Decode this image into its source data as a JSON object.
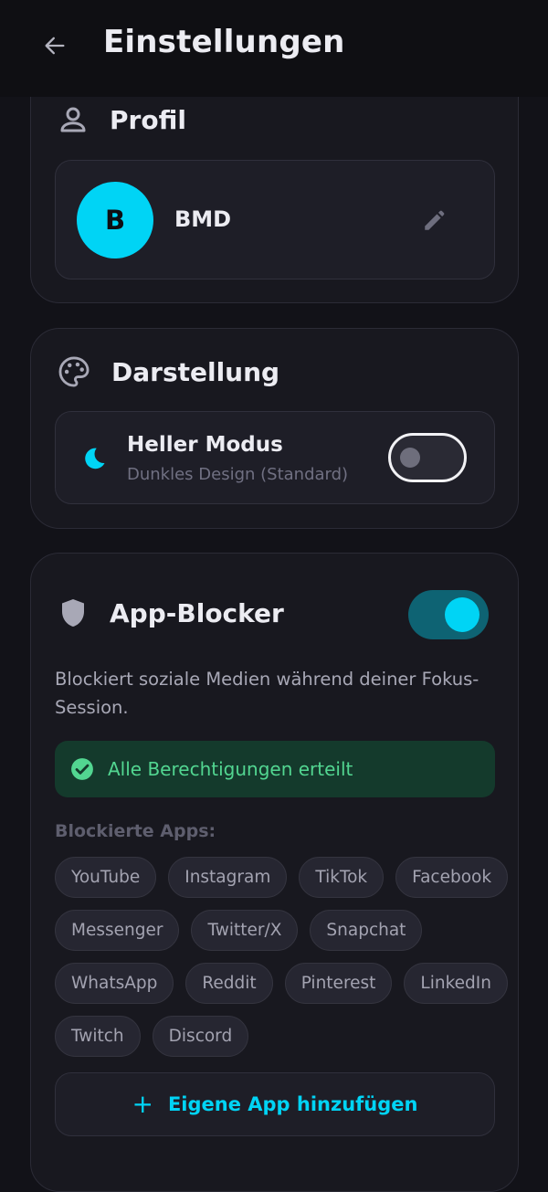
{
  "header": {
    "title": "Einstellungen"
  },
  "profile": {
    "section_title": "Profil",
    "avatar_initial": "B",
    "name": "BMD"
  },
  "appearance": {
    "section_title": "Darstellung",
    "mode_title": "Heller Modus",
    "mode_subtitle": "Dunkles Design (Standard)",
    "light_mode_enabled": false
  },
  "app_blocker": {
    "section_title": "App-Blocker",
    "enabled": true,
    "description": "Blockiert soziale Medien während deiner Fokus-Session.",
    "permission_status": "Alle Berechtigungen erteilt",
    "blocked_label": "Blockierte Apps:",
    "blocked_apps": [
      [
        "YouTube",
        "Instagram",
        "TikTok",
        "Facebook"
      ],
      [
        "Messenger",
        "Twitter/X",
        "Snapchat"
      ],
      [
        "WhatsApp",
        "Reddit",
        "Pinterest",
        "LinkedIn"
      ],
      [
        "Twitch",
        "Discord"
      ]
    ],
    "add_button_label": "Eigene App hinzufügen"
  },
  "colors": {
    "accent": "#00D4F5",
    "background": "#121218",
    "card": "#18181F",
    "success_bg": "#143A2C",
    "success_text": "#52D691"
  },
  "icons": {
    "back": "arrow-left-icon",
    "profile": "person-icon",
    "edit": "pencil-icon",
    "appearance": "palette-icon",
    "mode": "moon-icon",
    "blocker": "shield-icon",
    "permission": "check-circle-icon",
    "add": "plus-icon"
  }
}
